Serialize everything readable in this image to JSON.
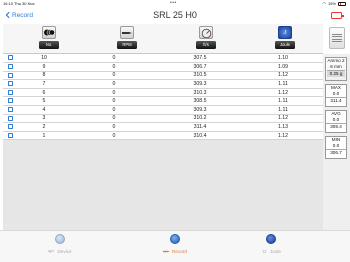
{
  "status_bar": {
    "time": "16:10",
    "date": "Thu 30 Nov",
    "dots": "•••",
    "battery_pct": "15%"
  },
  "nav": {
    "back_label": "Record",
    "title": "SRL 25 H0"
  },
  "columns": {
    "no": "No.",
    "rpm": "RPM",
    "fps": "ft/s",
    "joule": "Joule"
  },
  "rows": [
    {
      "no": "10",
      "rpm": "0",
      "fps": "307.5",
      "joule": "1.10"
    },
    {
      "no": "9",
      "rpm": "0",
      "fps": "306.7",
      "joule": "1.09"
    },
    {
      "no": "8",
      "rpm": "0",
      "fps": "310.5",
      "joule": "1.12"
    },
    {
      "no": "7",
      "rpm": "0",
      "fps": "309.3",
      "joule": "1.11"
    },
    {
      "no": "6",
      "rpm": "0",
      "fps": "310.3",
      "joule": "1.12"
    },
    {
      "no": "5",
      "rpm": "0",
      "fps": "308.5",
      "joule": "1.11"
    },
    {
      "no": "4",
      "rpm": "0",
      "fps": "309.3",
      "joule": "1.11"
    },
    {
      "no": "3",
      "rpm": "0",
      "fps": "310.2",
      "joule": "1.12"
    },
    {
      "no": "2",
      "rpm": "0",
      "fps": "311.4",
      "joule": "1.13"
    },
    {
      "no": "1",
      "rpm": "0",
      "fps": "310.4",
      "joule": "1.12"
    }
  ],
  "ammo": {
    "name": "Ammo 2",
    "size": "6 mm",
    "weight": "0.25 g"
  },
  "stats": {
    "max": {
      "label": "MAX",
      "rpm": "0.0",
      "fps": "311.4"
    },
    "avg": {
      "label": "AVG",
      "rpm": "0.0",
      "fps": "309.4"
    },
    "min": {
      "label": "MIN",
      "rpm": "0.0",
      "fps": "306.7"
    }
  },
  "tabs": [
    {
      "label": "Device",
      "icon": "device-icon",
      "active": false
    },
    {
      "label": "Record",
      "icon": "record-icon",
      "active": true
    },
    {
      "label": "Joule",
      "icon": "joule-icon",
      "active": false
    }
  ],
  "colors": {
    "accent": "#2f7bd6",
    "active_tab": "#e07a3a",
    "alert": "#e53935"
  }
}
